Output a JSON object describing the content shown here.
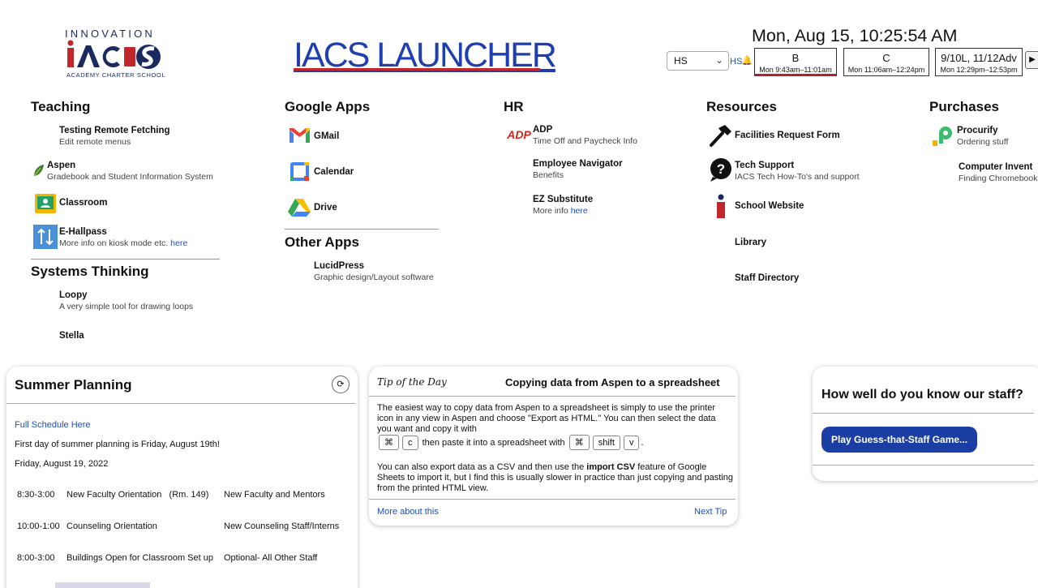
{
  "header": {
    "logo_top": "INNOVATION",
    "logo_main": "IACS",
    "logo_bottom": "ACADEMY CHARTER SCHOOL",
    "title": "IACS LAUNCHER",
    "clock": "Mon, Aug 15, 10:25:54 AM",
    "school_select": "HS",
    "hs_tag": "HS",
    "periods": [
      {
        "name": "B",
        "time": "Mon 9:43am–11:01am",
        "current": true
      },
      {
        "name": "C",
        "time": "Mon 11:06am–12:24pm",
        "current": false
      },
      {
        "name": "9/10L, 11/12Adv",
        "time": "Mon 12:29pm–12:53pm",
        "current": false
      }
    ],
    "next_label": "▶"
  },
  "teaching": {
    "title": "Teaching",
    "items": [
      {
        "title": "Testing Remote Fetching",
        "sub": "Edit remote menus"
      },
      {
        "title": "Aspen",
        "sub": "Gradebook and Student Information System"
      },
      {
        "title": "Classroom",
        "sub": ""
      },
      {
        "title": "E-Hallpass",
        "sub": "More info on kiosk mode etc. ",
        "link": "here"
      }
    ]
  },
  "systems": {
    "title": "Systems Thinking",
    "items": [
      {
        "title": "Loopy",
        "sub": "A very simple tool for drawing loops"
      },
      {
        "title": "Stella",
        "sub": ""
      }
    ]
  },
  "google": {
    "title": "Google Apps",
    "items": [
      {
        "title": "GMail"
      },
      {
        "title": "Calendar"
      },
      {
        "title": "Drive"
      }
    ]
  },
  "other": {
    "title": "Other Apps",
    "items": [
      {
        "title": "LucidPress",
        "sub": "Graphic design/Layout software"
      }
    ]
  },
  "hr": {
    "title": "HR",
    "items": [
      {
        "title": "ADP",
        "sub": "Time Off and Paycheck Info",
        "icon_text": "ADP"
      },
      {
        "title": "Employee Navigator",
        "sub": "Benefits"
      },
      {
        "title": "EZ Substitute",
        "sub": "More info ",
        "link": "here"
      }
    ]
  },
  "resources": {
    "title": "Resources",
    "items": [
      {
        "title": "Facilities Request Form",
        "sub": ""
      },
      {
        "title": "Tech Support",
        "sub": "IACS Tech How-To's and support"
      },
      {
        "title": "School Website",
        "sub": ""
      },
      {
        "title": "Library",
        "sub": ""
      },
      {
        "title": "Staff Directory",
        "sub": ""
      }
    ]
  },
  "purchases": {
    "title": "Purchases",
    "items": [
      {
        "title": "Procurify",
        "sub": "Ordering stuff"
      },
      {
        "title": "Computer Invent",
        "sub": "Finding Chromebook"
      }
    ]
  },
  "summer": {
    "title": "Summer Planning",
    "refresh": "⟳",
    "link": "Full Schedule Here",
    "line1": "First day of summer planning is Friday, August 19th!",
    "date": "Friday, August 19, 2022",
    "rows": [
      {
        "time": "8:30-3:00",
        "event": "New Faculty Orientation   (Rm. 149)",
        "who": "New Faculty and Mentors"
      },
      {
        "time": "10:00-1:00",
        "event": "Counseling Orientation",
        "who": "New Counseling Staff/Interns"
      },
      {
        "time": "8:00-3:00",
        "event": "Buildings Open for Classroom Set up",
        "who": "Optional- All Other Staff"
      }
    ]
  },
  "tip": {
    "label": "Tip of the Day",
    "title": "Copying data from Aspen to a spreadsheet",
    "p1": "The easiest way to copy data from Aspen to a spreadsheet is simply to use the printer icon in any view in Aspen and choose \"Export as HTML.\" You can then select the data you want and copy it with",
    "keys1": [
      "⌘",
      "c"
    ],
    "mid": "then paste it into a spreadsheet with",
    "keys2": [
      "⌘",
      "shift",
      "v"
    ],
    "end": ".",
    "p2a": "You can also export data as a CSV and then use the ",
    "p2b": "import CSV",
    "p2c": " feature of Google Sheets to import it, but I find this is usually slower in practice than just copying and pasting from the printed HTML view.",
    "more": "More about this",
    "next": "Next Tip"
  },
  "staff_game": {
    "title": "How well do you know our staff?",
    "button": "Play Guess-that-Staff Game..."
  },
  "colors": {
    "brand_blue": "#1f3fb0",
    "brand_red": "#c0282e",
    "link": "#1f4fb5",
    "button": "#1b3ea5"
  }
}
